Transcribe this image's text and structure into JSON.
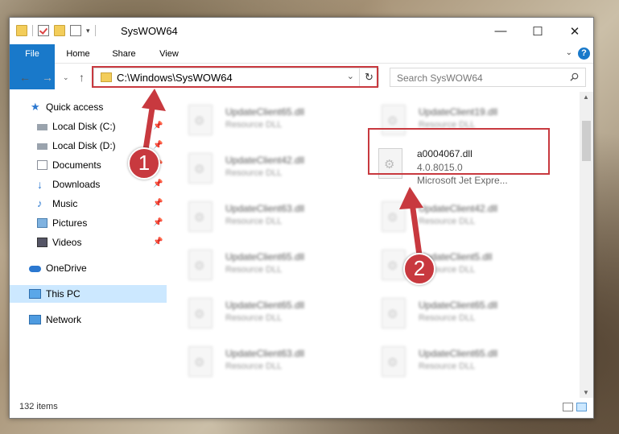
{
  "window": {
    "title": "SysWOW64"
  },
  "ribbon": {
    "tabs": [
      "File",
      "Home",
      "Share",
      "View"
    ],
    "help": "?"
  },
  "nav": {
    "address": "C:\\Windows\\SysWOW64",
    "search_placeholder": "Search SysWOW64"
  },
  "sidebar": {
    "items": [
      {
        "label": "Quick access",
        "icon": "star-icon"
      },
      {
        "label": "Local Disk (C:)",
        "icon": "drive-icon",
        "pinned": true
      },
      {
        "label": "Local Disk (D:)",
        "icon": "drive-icon",
        "pinned": true
      },
      {
        "label": "Documents",
        "icon": "documents-icon",
        "pinned": true
      },
      {
        "label": "Downloads",
        "icon": "downloads-icon",
        "pinned": true
      },
      {
        "label": "Music",
        "icon": "music-icon",
        "pinned": true
      },
      {
        "label": "Pictures",
        "icon": "pictures-icon",
        "pinned": true
      },
      {
        "label": "Videos",
        "icon": "videos-icon",
        "pinned": true
      },
      {
        "label": "OneDrive",
        "icon": "cloud-icon"
      },
      {
        "label": "This PC",
        "icon": "computer-icon",
        "selected": true
      },
      {
        "label": "Network",
        "icon": "network-icon"
      }
    ]
  },
  "files": {
    "left": [
      {
        "name": "UpdateClient65.dll",
        "desc": "Resource DLL"
      },
      {
        "name": "UpdateClient42.dll",
        "desc": "Resource DLL"
      },
      {
        "name": "UpdateClient63.dll",
        "desc": "Resource DLL"
      },
      {
        "name": "UpdateClient65.dll",
        "desc": "Resource DLL"
      },
      {
        "name": "UpdateClient65.dll",
        "desc": "Resource DLL"
      },
      {
        "name": "UpdateClient63.dll",
        "desc": "Resource DLL"
      }
    ],
    "right": [
      {
        "name": "UpdateClient19.dll",
        "desc": "Resource DLL"
      },
      {
        "name": "a0004067.dll",
        "desc": "4.0.8015.0",
        "desc2": "Microsoft Jet Expre...",
        "highlight": true
      },
      {
        "name": "UpdateClient42.dll",
        "desc": "Resource DLL"
      },
      {
        "name": "UpdateClient5.dll",
        "desc": "Resource DLL"
      },
      {
        "name": "UpdateClient65.dll",
        "desc": "Resource DLL"
      },
      {
        "name": "UpdateClient65.dll",
        "desc": "Resource DLL"
      }
    ]
  },
  "status": {
    "item_count": "132 items"
  },
  "annotations": {
    "step1": "1",
    "step2": "2",
    "color": "#c8393f"
  }
}
